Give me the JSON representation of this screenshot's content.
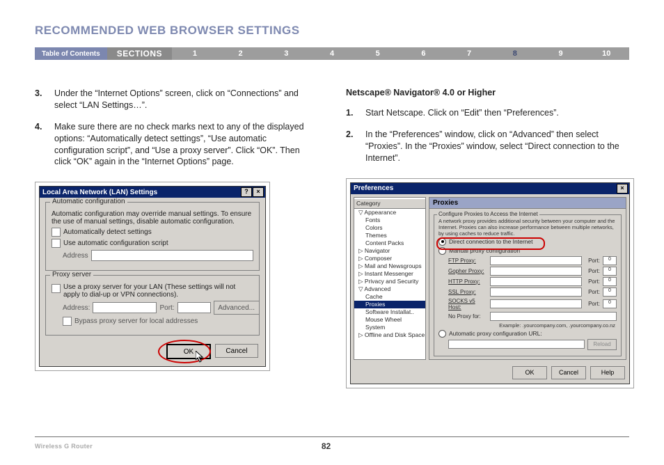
{
  "page_title": "RECOMMENDED WEB BROWSER SETTINGS",
  "nav": {
    "toc": "Table of Contents",
    "sections_label": "SECTIONS",
    "items": [
      "1",
      "2",
      "3",
      "4",
      "5",
      "6",
      "7",
      "8",
      "9",
      "10"
    ],
    "current": "8"
  },
  "left": {
    "step3_num": "3.",
    "step3": "Under the “Internet Options” screen, click on “Connections” and select “LAN Settings…”.",
    "step4_num": "4.",
    "step4": "Make sure there are no check marks next to any of the displayed options: “Automatically detect settings”, “Use automatic configuration script”, and “Use a proxy server”. Click “OK”. Then click “OK” again in the “Internet Options” page."
  },
  "right": {
    "subhead": "Netscape® Navigator® 4.0 or Higher",
    "step1_num": "1.",
    "step1": "Start Netscape. Click on “Edit” then “Preferences”.",
    "step2_num": "2.",
    "step2": "In the “Preferences” window, click on “Advanced” then select “Proxies”. In the “Proxies” window, select “Direct connection to the Internet”."
  },
  "lan": {
    "title": "Local Area Network (LAN) Settings",
    "help_btn": "?",
    "close_btn": "×",
    "grp_auto": "Automatic configuration",
    "auto_hint": "Automatic configuration may override manual settings.  To ensure the use of manual settings, disable automatic configuration.",
    "cb_detect": "Automatically detect settings",
    "cb_script": "Use automatic configuration script",
    "addr_label": "Address",
    "grp_proxy": "Proxy server",
    "cb_proxy": "Use a proxy server for your LAN (These settings will not apply to dial-up or VPN connections).",
    "addr2_label": "Address:",
    "port_label": "Port:",
    "adv_btn": "Advanced...",
    "cb_bypass": "Bypass proxy server for local addresses",
    "ok": "OK",
    "cancel": "Cancel"
  },
  "pref": {
    "title": "Preferences",
    "close_btn": "×",
    "tree_header": "Category",
    "tree": [
      {
        "t": "Appearance",
        "l": 1
      },
      {
        "t": "Fonts",
        "l": 2
      },
      {
        "t": "Colors",
        "l": 2
      },
      {
        "t": "Themes",
        "l": 2
      },
      {
        "t": "Content Packs",
        "l": 2
      },
      {
        "t": "Navigator",
        "l": 1
      },
      {
        "t": "Composer",
        "l": 1
      },
      {
        "t": "Mail and Newsgroups",
        "l": 1
      },
      {
        "t": "Instant Messenger",
        "l": 1
      },
      {
        "t": "Privacy and Security",
        "l": 1
      },
      {
        "t": "Advanced",
        "l": 1
      },
      {
        "t": "Cache",
        "l": 2
      },
      {
        "t": "Proxies",
        "l": 2,
        "sel": true
      },
      {
        "t": "Software Installat..",
        "l": 2
      },
      {
        "t": "Mouse Wheel",
        "l": 2
      },
      {
        "t": "System",
        "l": 2
      },
      {
        "t": "Offline and Disk Space",
        "l": 1
      }
    ],
    "panel_head": "Proxies",
    "fs_legend": "Configure Proxies to Access the Internet",
    "fs_hint": "A network proxy provides additional security between your computer and the Internet. Proxies can also increase performance between multiple networks, by using caches to reduce traffic.",
    "r_direct": "Direct connection to the Internet",
    "r_manual": "Manual proxy configuration",
    "rows": [
      {
        "label": "FTP Proxy:",
        "port": "Port:",
        "pv": "0"
      },
      {
        "label": "Gopher Proxy:",
        "port": "Port:",
        "pv": "0"
      },
      {
        "label": "HTTP Proxy:",
        "port": "Port:",
        "pv": "0"
      },
      {
        "label": "SSL Proxy:",
        "port": "Port:",
        "pv": "0"
      },
      {
        "label": "SOCKS v5 Host:",
        "port": "Port:",
        "pv": "0"
      }
    ],
    "noproxy": "No Proxy for:",
    "example": "Example: .yourcompany.com, .yourcompany.co.nz",
    "r_auto": "Automatic proxy configuration URL:",
    "reload": "Reload",
    "ok": "OK",
    "cancel": "Cancel",
    "help": "Help"
  },
  "footer": {
    "product": "Wireless G Router",
    "page": "82"
  }
}
